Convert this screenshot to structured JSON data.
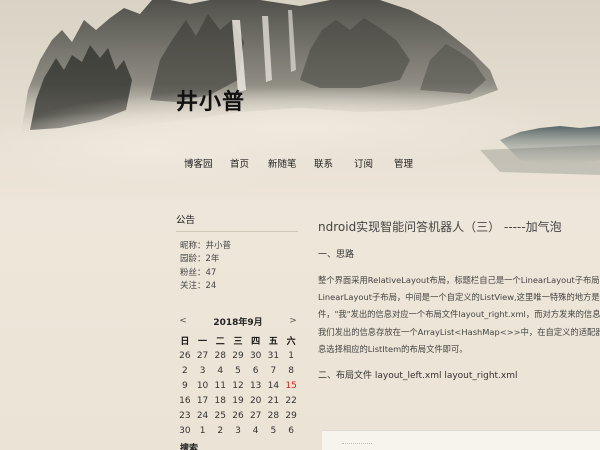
{
  "site": {
    "title": "井小普"
  },
  "nav": {
    "items": [
      "博客园",
      "首页",
      "新随笔",
      "联系",
      "订阅",
      "管理"
    ]
  },
  "sidebar": {
    "notice_heading": "公告",
    "profile": [
      "昵称：井小普",
      "园龄：2年",
      "粉丝：47",
      "关注：24"
    ],
    "calendar": {
      "prev": "<",
      "next": ">",
      "title": "2018年9月",
      "weekdays": [
        "日",
        "一",
        "二",
        "三",
        "四",
        "五",
        "六"
      ],
      "weeks": [
        [
          "26",
          "27",
          "28",
          "29",
          "30",
          "31",
          "1"
        ],
        [
          "2",
          "3",
          "4",
          "5",
          "6",
          "7",
          "8"
        ],
        [
          "9",
          "10",
          "11",
          "12",
          "13",
          "14",
          "15"
        ],
        [
          "16",
          "17",
          "18",
          "19",
          "20",
          "21",
          "22"
        ],
        [
          "23",
          "24",
          "25",
          "26",
          "27",
          "28",
          "29"
        ],
        [
          "30",
          "1",
          "2",
          "3",
          "4",
          "5",
          "6"
        ]
      ],
      "today": "15",
      "today_color": "#c8281e"
    },
    "search_heading": "搜索"
  },
  "post": {
    "title": "ndroid实现智能问答机器人（三） -----加气泡",
    "section1": "一、思路",
    "paragraph_lines": [
      "整个界面采用RelativeLayout布局，标题栏自己是一个LinearLayout子布局，",
      "LinearLayout子布局，中间是一个自定义的ListView,这里唯一特殊的地方是Li",
      "件，\"我\"发出的信息对应一个布局文件layout_right.xml，而对方发来的信息对",
      "我们发出的信息存放在一个ArrayList<HashMap<>>中，在自定义的适配器的",
      "息选择相应的ListItem的布局文件即可。"
    ],
    "section2": "二、布局文件 layout_left.xml  layout_right.xml"
  }
}
